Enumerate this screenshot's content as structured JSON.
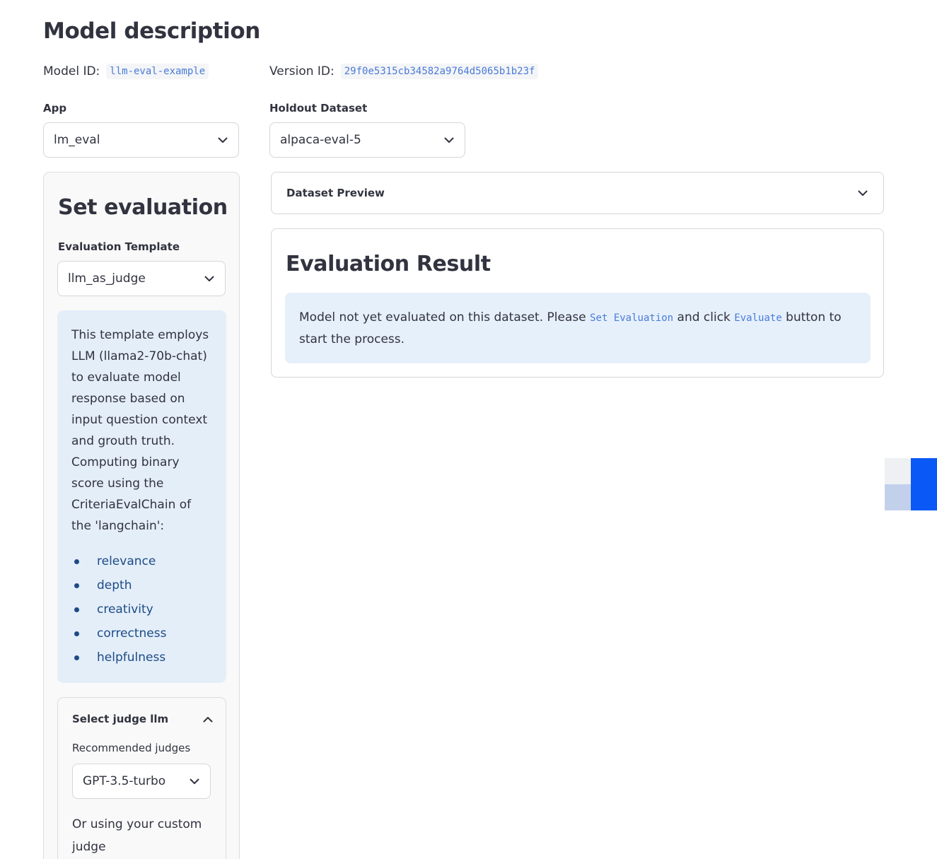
{
  "page": {
    "title": "Model description"
  },
  "ids": {
    "model_label": "Model ID:",
    "model_value": "llm-eval-example",
    "version_label": "Version ID:",
    "version_value": "29f0e5315cb34582a9764d5065b1b23f"
  },
  "app": {
    "label": "App",
    "selected": "lm_eval"
  },
  "holdout": {
    "label": "Holdout Dataset",
    "selected": "alpaca-eval-5"
  },
  "set_evaluation": {
    "title": "Set evaluation",
    "template_label": "Evaluation Template",
    "template_selected": "llm_as_judge",
    "description": "This template employs LLM (llama2-70b-chat) to evaluate model response based on input question context and grouth truth. Computing binary score using the CriteriaEvalChain of the 'langchain':",
    "criteria": [
      "relevance",
      "depth",
      "creativity",
      "correctness",
      "helpfulness"
    ],
    "judge_section_label": "Select judge llm",
    "recommended_label": "Recommended judges",
    "recommended_selected": "GPT-3.5-turbo",
    "custom_text": "Or using your custom judge"
  },
  "dataset_preview": {
    "label": "Dataset Preview"
  },
  "evaluation_result": {
    "title": "Evaluation Result",
    "message_part1": "Model not yet evaluated on this dataset. Please ",
    "code1": "Set Evaluation",
    "message_part2": " and click ",
    "code2": "Evaluate",
    "message_part3": " button to start the process."
  },
  "colors": {
    "accent_blue": "#0a58f5",
    "info_bg": "#e4eef9",
    "code_text": "#4a7bd8",
    "list_text": "#1c4b86"
  }
}
